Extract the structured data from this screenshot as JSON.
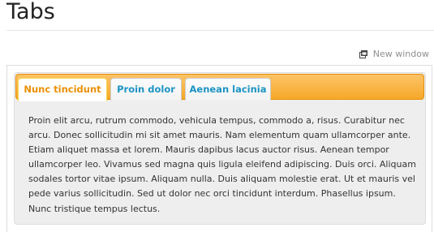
{
  "page": {
    "title": "Tabs",
    "new_window_label": "New window",
    "new_window_icon": "external-window-icon"
  },
  "tabs": {
    "items": [
      {
        "label": "Nunc tincidunt",
        "active": true
      },
      {
        "label": "Proin dolor",
        "active": false
      },
      {
        "label": "Aenean lacinia",
        "active": false
      }
    ],
    "panel_text": "Proin elit arcu, rutrum commodo, vehicula tempus, commodo a, risus. Curabitur nec arcu. Donec sollicitudin mi sit amet mauris. Nam elementum quam ullamcorper ante. Etiam aliquet massa et lorem. Mauris dapibus lacus auctor risus. Aenean tempor ullamcorper leo. Vivamus sed magna quis ligula eleifend adipiscing. Duis orci. Aliquam sodales tortor vitae ipsum. Aliquam nulla. Duis aliquam molestie erat. Ut et mauris vel pede varius sollicitudin. Sed ut dolor nec orci tincidunt interdum. Phasellus ipsum. Nunc tristique tempus lectus."
  },
  "colors": {
    "header_gradient_top": "#fcc468",
    "header_gradient_bottom": "#f6a828",
    "active_tab_text": "#eb8f00",
    "inactive_tab_text": "#1c94c4",
    "panel_background": "#eeeeee"
  }
}
